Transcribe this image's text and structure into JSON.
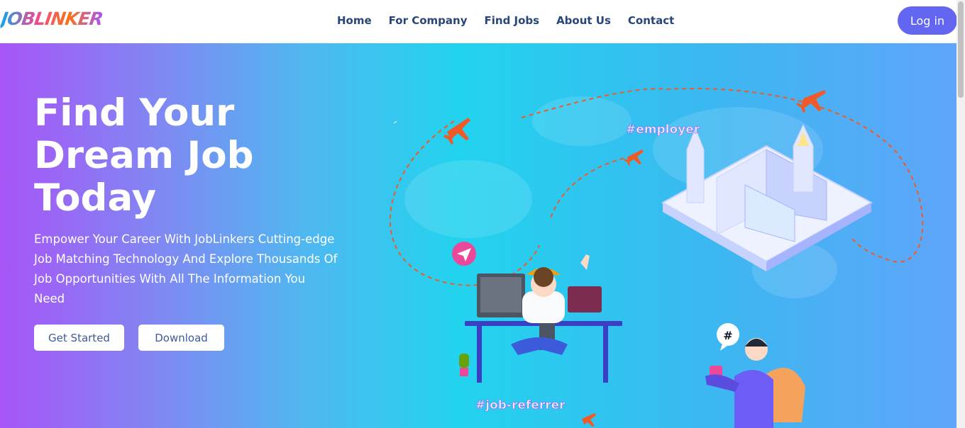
{
  "nav": {
    "logo": "JOBLINKER",
    "links": [
      "Home",
      "For Company",
      "Find Jobs",
      "About Us",
      "Contact"
    ],
    "login_label": "Log in"
  },
  "hero": {
    "title": "Find Your Dream Job Today",
    "subtitle": "Empower Your Career With JobLinkers Cutting-edge Job Matching Technology And Explore Thousands Of Job Opportunities With All The Information You Need",
    "cta_primary": "Get Started",
    "cta_secondary": "Download"
  },
  "illustration": {
    "tag_employer": "#employer",
    "tag_referrer": "#job-referrer",
    "bubble_symbol": "#"
  },
  "colors": {
    "brand": "#6366f1",
    "nav_text": "#27467a",
    "gradient_start": "#a855f7",
    "gradient_mid": "#22d3ee",
    "gradient_end": "#60a5fa",
    "accent_orange": "#f05a28"
  }
}
